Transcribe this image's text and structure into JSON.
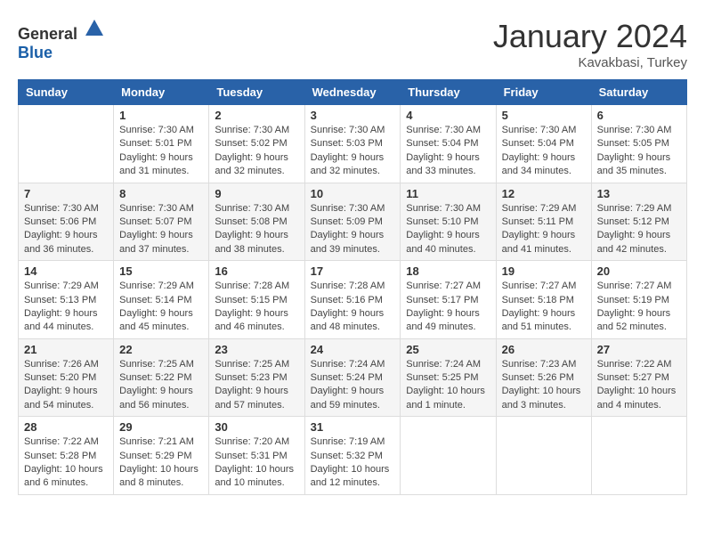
{
  "header": {
    "logo_general": "General",
    "logo_blue": "Blue",
    "month": "January 2024",
    "location": "Kavakbasi, Turkey"
  },
  "days_of_week": [
    "Sunday",
    "Monday",
    "Tuesday",
    "Wednesday",
    "Thursday",
    "Friday",
    "Saturday"
  ],
  "weeks": [
    [
      {
        "day": "",
        "info": ""
      },
      {
        "day": "1",
        "info": "Sunrise: 7:30 AM\nSunset: 5:01 PM\nDaylight: 9 hours\nand 31 minutes."
      },
      {
        "day": "2",
        "info": "Sunrise: 7:30 AM\nSunset: 5:02 PM\nDaylight: 9 hours\nand 32 minutes."
      },
      {
        "day": "3",
        "info": "Sunrise: 7:30 AM\nSunset: 5:03 PM\nDaylight: 9 hours\nand 32 minutes."
      },
      {
        "day": "4",
        "info": "Sunrise: 7:30 AM\nSunset: 5:04 PM\nDaylight: 9 hours\nand 33 minutes."
      },
      {
        "day": "5",
        "info": "Sunrise: 7:30 AM\nSunset: 5:04 PM\nDaylight: 9 hours\nand 34 minutes."
      },
      {
        "day": "6",
        "info": "Sunrise: 7:30 AM\nSunset: 5:05 PM\nDaylight: 9 hours\nand 35 minutes."
      }
    ],
    [
      {
        "day": "7",
        "info": "Sunrise: 7:30 AM\nSunset: 5:06 PM\nDaylight: 9 hours\nand 36 minutes."
      },
      {
        "day": "8",
        "info": "Sunrise: 7:30 AM\nSunset: 5:07 PM\nDaylight: 9 hours\nand 37 minutes."
      },
      {
        "day": "9",
        "info": "Sunrise: 7:30 AM\nSunset: 5:08 PM\nDaylight: 9 hours\nand 38 minutes."
      },
      {
        "day": "10",
        "info": "Sunrise: 7:30 AM\nSunset: 5:09 PM\nDaylight: 9 hours\nand 39 minutes."
      },
      {
        "day": "11",
        "info": "Sunrise: 7:30 AM\nSunset: 5:10 PM\nDaylight: 9 hours\nand 40 minutes."
      },
      {
        "day": "12",
        "info": "Sunrise: 7:29 AM\nSunset: 5:11 PM\nDaylight: 9 hours\nand 41 minutes."
      },
      {
        "day": "13",
        "info": "Sunrise: 7:29 AM\nSunset: 5:12 PM\nDaylight: 9 hours\nand 42 minutes."
      }
    ],
    [
      {
        "day": "14",
        "info": "Sunrise: 7:29 AM\nSunset: 5:13 PM\nDaylight: 9 hours\nand 44 minutes."
      },
      {
        "day": "15",
        "info": "Sunrise: 7:29 AM\nSunset: 5:14 PM\nDaylight: 9 hours\nand 45 minutes."
      },
      {
        "day": "16",
        "info": "Sunrise: 7:28 AM\nSunset: 5:15 PM\nDaylight: 9 hours\nand 46 minutes."
      },
      {
        "day": "17",
        "info": "Sunrise: 7:28 AM\nSunset: 5:16 PM\nDaylight: 9 hours\nand 48 minutes."
      },
      {
        "day": "18",
        "info": "Sunrise: 7:27 AM\nSunset: 5:17 PM\nDaylight: 9 hours\nand 49 minutes."
      },
      {
        "day": "19",
        "info": "Sunrise: 7:27 AM\nSunset: 5:18 PM\nDaylight: 9 hours\nand 51 minutes."
      },
      {
        "day": "20",
        "info": "Sunrise: 7:27 AM\nSunset: 5:19 PM\nDaylight: 9 hours\nand 52 minutes."
      }
    ],
    [
      {
        "day": "21",
        "info": "Sunrise: 7:26 AM\nSunset: 5:20 PM\nDaylight: 9 hours\nand 54 minutes."
      },
      {
        "day": "22",
        "info": "Sunrise: 7:25 AM\nSunset: 5:22 PM\nDaylight: 9 hours\nand 56 minutes."
      },
      {
        "day": "23",
        "info": "Sunrise: 7:25 AM\nSunset: 5:23 PM\nDaylight: 9 hours\nand 57 minutes."
      },
      {
        "day": "24",
        "info": "Sunrise: 7:24 AM\nSunset: 5:24 PM\nDaylight: 9 hours\nand 59 minutes."
      },
      {
        "day": "25",
        "info": "Sunrise: 7:24 AM\nSunset: 5:25 PM\nDaylight: 10 hours\nand 1 minute."
      },
      {
        "day": "26",
        "info": "Sunrise: 7:23 AM\nSunset: 5:26 PM\nDaylight: 10 hours\nand 3 minutes."
      },
      {
        "day": "27",
        "info": "Sunrise: 7:22 AM\nSunset: 5:27 PM\nDaylight: 10 hours\nand 4 minutes."
      }
    ],
    [
      {
        "day": "28",
        "info": "Sunrise: 7:22 AM\nSunset: 5:28 PM\nDaylight: 10 hours\nand 6 minutes."
      },
      {
        "day": "29",
        "info": "Sunrise: 7:21 AM\nSunset: 5:29 PM\nDaylight: 10 hours\nand 8 minutes."
      },
      {
        "day": "30",
        "info": "Sunrise: 7:20 AM\nSunset: 5:31 PM\nDaylight: 10 hours\nand 10 minutes."
      },
      {
        "day": "31",
        "info": "Sunrise: 7:19 AM\nSunset: 5:32 PM\nDaylight: 10 hours\nand 12 minutes."
      },
      {
        "day": "",
        "info": ""
      },
      {
        "day": "",
        "info": ""
      },
      {
        "day": "",
        "info": ""
      }
    ]
  ]
}
